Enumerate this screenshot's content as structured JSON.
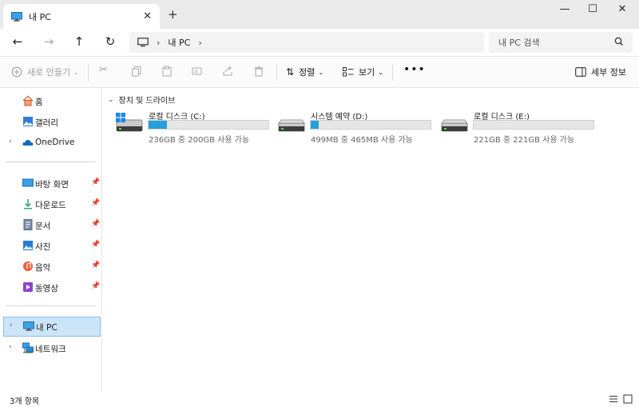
{
  "tab": {
    "title": "내 PC"
  },
  "address": {
    "location": "내 PC"
  },
  "search": {
    "placeholder": "내 PC 검색"
  },
  "toolbar": {
    "new_label": "새로 만들기",
    "sort_label": "정렬",
    "view_label": "보기",
    "details_label": "세부 정보"
  },
  "sidebar": {
    "home": "홈",
    "gallery": "갤러리",
    "onedrive": "OneDrive",
    "desktop": "바탕 화면",
    "downloads": "다운로드",
    "documents": "문서",
    "pictures": "사진",
    "music": "음악",
    "videos": "동영상",
    "this_pc": "내 PC",
    "network": "네트워크"
  },
  "content": {
    "group_title": "장치 및 드라이브",
    "drives": [
      {
        "name": "로컬 디스크 (C:)",
        "info": "236GB 중 200GB 사용 가능",
        "used_fraction": 0.153
      },
      {
        "name": "시스템 예약 (D:)",
        "info": "499MB 중 465MB 사용 가능",
        "used_fraction": 0.068
      },
      {
        "name": "로컬 디스크 (E:)",
        "info": "221GB 중 221GB 사용 가능",
        "used_fraction": 0.0
      }
    ]
  },
  "status": {
    "item_count": "3개 항목"
  },
  "colors": {
    "accent": "#26a0da",
    "selection": "#cce4f7"
  }
}
